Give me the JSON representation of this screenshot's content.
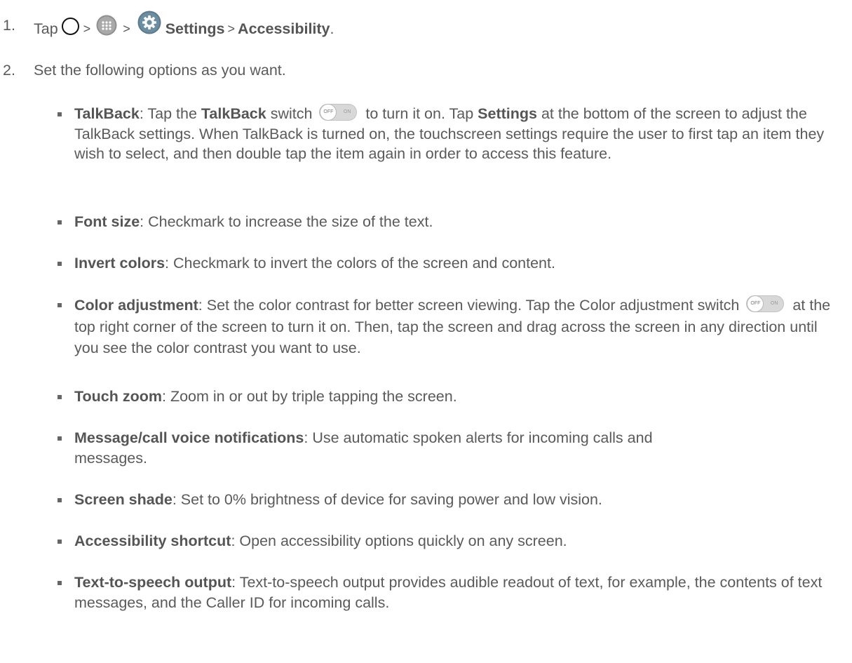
{
  "steps": [
    {
      "number": "1.",
      "tap": "Tap",
      "sep1": ">",
      "sep2": ">",
      "settings": "Settings",
      "sep3": ">",
      "accessibility": "Accessibility",
      "end": "."
    },
    {
      "number": "2.",
      "text": "Set the following options as you want."
    }
  ],
  "switch": {
    "off": "OFF",
    "on": "ON"
  },
  "options": {
    "talkback": {
      "label": "TalkBack",
      "t1": ": Tap the ",
      "label2": "TalkBack",
      "t2": " switch",
      "t3": " to turn it on. Tap ",
      "settings": "Settings",
      "t4": " at the bottom of the screen to adjust the TalkBack settings. When TalkBack is turned on, the touchscreen settings require the user to first tap an item they wish to select, and then double tap the item again in order to access this feature."
    },
    "font_size": {
      "label": "Font size",
      "text": ": Checkmark to increase the size of the text."
    },
    "invert_colors": {
      "label": "Invert colors",
      "text": ": Checkmark to invert the colors of the screen and content."
    },
    "color_adjustment": {
      "label": "Color adjustment",
      "t1": ": Set the color contrast for better screen viewing. Tap the Color adjustment switch",
      "t2": " at the top right corner of the screen to turn it on. Then, tap the screen and drag across the screen in any direction until you see the color contrast you want to use."
    },
    "touch_zoom": {
      "label": "Touch zoom",
      "text": ": Zoom in or out by triple tapping the screen."
    },
    "voice_notifications": {
      "label": "Message/call voice notifications",
      "text": ": Use automatic spoken alerts for incoming calls and messages."
    },
    "screen_shade": {
      "label": "Screen shade",
      "text": ": Set to 0% brightness of device for saving power and low vision."
    },
    "accessibility_shortcut": {
      "label": "Accessibility shortcut",
      "text": ": Open accessibility options quickly on any screen."
    },
    "tts_output": {
      "label": "Text-to-speech output",
      "text": ": Text-to-speech output provides audible readout of text, for example, the contents of text messages, and the Caller ID for incoming calls."
    }
  },
  "icons": {
    "home": "home-button-icon",
    "apps": "apps-icon",
    "settings": "settings-gear-icon",
    "switch": "toggle-switch-icon"
  },
  "colors": {
    "text": "#5a5a5a",
    "apps_icon": "#9e9e9e",
    "settings_icon": "#607d8b"
  }
}
